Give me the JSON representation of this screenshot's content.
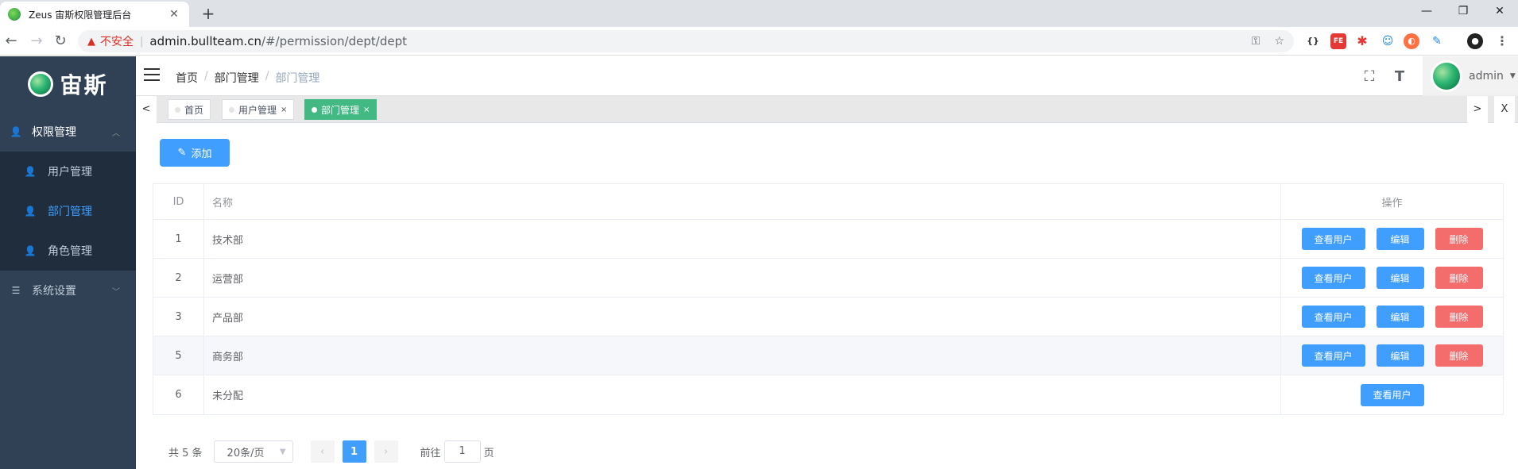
{
  "browser": {
    "tab_title": "Zeus 宙斯权限管理后台",
    "tab_close": "✕",
    "new_tab": "+",
    "win_min": "—",
    "win_max": "❐",
    "win_close": "✕",
    "security_label": "不安全",
    "url_host": "admin.bullteam.cn",
    "url_path": "/#/permission/dept/dept"
  },
  "app": {
    "logo_text": "宙斯",
    "sidebar": {
      "group1_label": "权限管理",
      "sub_items": [
        {
          "label": "用户管理"
        },
        {
          "label": "部门管理"
        },
        {
          "label": "角色管理"
        }
      ],
      "group2_label": "系统设置"
    },
    "breadcrumb": [
      "首页",
      "部门管理",
      "部门管理"
    ],
    "breadcrumb_sep": "/",
    "user_name": "admin",
    "tags": {
      "prev": "<",
      "next": ">",
      "close_all": "X",
      "items": [
        {
          "label": "首页"
        },
        {
          "label": "用户管理"
        },
        {
          "label": "部门管理"
        }
      ],
      "close_mark": "×"
    },
    "add_button": "添加",
    "table": {
      "headers": {
        "id": "ID",
        "name": "名称",
        "op": "操作"
      },
      "rows": [
        {
          "id": "1",
          "name": "技术部"
        },
        {
          "id": "2",
          "name": "运营部"
        },
        {
          "id": "3",
          "name": "产品部"
        },
        {
          "id": "5",
          "name": "商务部"
        },
        {
          "id": "6",
          "name": "未分配"
        }
      ],
      "btn_view": "查看用户",
      "btn_edit": "编辑",
      "btn_delete": "删除"
    },
    "pagination": {
      "total": "共 5 条",
      "page_size": "20条/页",
      "current_page": "1",
      "goto_prefix": "前往",
      "goto_value": "1",
      "goto_suffix": "页"
    }
  },
  "colors": {
    "primary": "#409eff",
    "danger": "#f56c6c",
    "sidebar": "#304156",
    "active_tag": "#42b983"
  }
}
